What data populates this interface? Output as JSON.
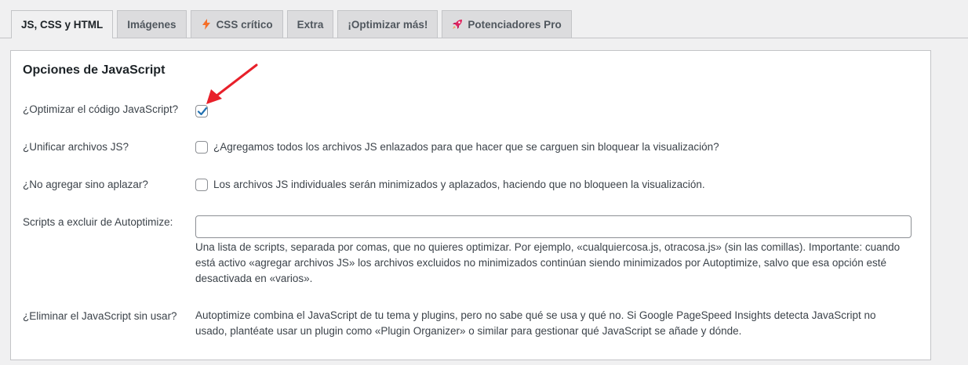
{
  "tabs": [
    {
      "label": "JS, CSS y HTML",
      "icon": null,
      "active": true
    },
    {
      "label": "Imágenes",
      "icon": null,
      "active": false
    },
    {
      "label": "CSS crítico",
      "icon": "lightning-icon",
      "active": false
    },
    {
      "label": "Extra",
      "icon": null,
      "active": false
    },
    {
      "label": "¡Optimizar más!",
      "icon": null,
      "active": false
    },
    {
      "label": "Potenciadores Pro",
      "icon": "rocket-icon",
      "active": false
    }
  ],
  "section": {
    "title": "Opciones de JavaScript"
  },
  "options": {
    "optimize_js": {
      "label": "¿Optimizar el código JavaScript?",
      "checked": true
    },
    "aggregate_js": {
      "label": "¿Unificar archivos JS?",
      "checked": false,
      "description": "¿Agregamos todos los archivos JS enlazados para que hacer que se carguen sin bloquear la visualización?"
    },
    "defer_not_aggregate": {
      "label": "¿No agregar sino aplazar?",
      "checked": false,
      "description": "Los archivos JS individuales serán minimizados y aplazados, haciendo que no bloqueen la visualización."
    },
    "exclude_scripts": {
      "label": "Scripts a excluir de Autoptimize:",
      "value": "",
      "help": "Una lista de scripts, separada por comas, que no quieres optimizar. Por ejemplo, «cualquiercosa.js, otracosa.js» (sin las comillas). Importante: cuando está activo «agregar archivos JS» los archivos excluidos no minimizados continúan siendo minimizados por Autoptimize, salvo que esa opción esté desactivada en «varios»."
    },
    "remove_unused_js": {
      "label": "¿Eliminar el JavaScript sin usar?",
      "description": "Autoptimize combina el JavaScript de tu tema y plugins, pero no sabe qué se usa y qué no. Si Google PageSpeed Insights detecta JavaScript no usado, plantéate usar un plugin como «Plugin Organizer» o similar para gestionar qué JavaScript se añade y dónde."
    }
  },
  "colors": {
    "accent": "#2271b1",
    "annotation_arrow": "#e8202a",
    "lightning": "#f56e28"
  }
}
